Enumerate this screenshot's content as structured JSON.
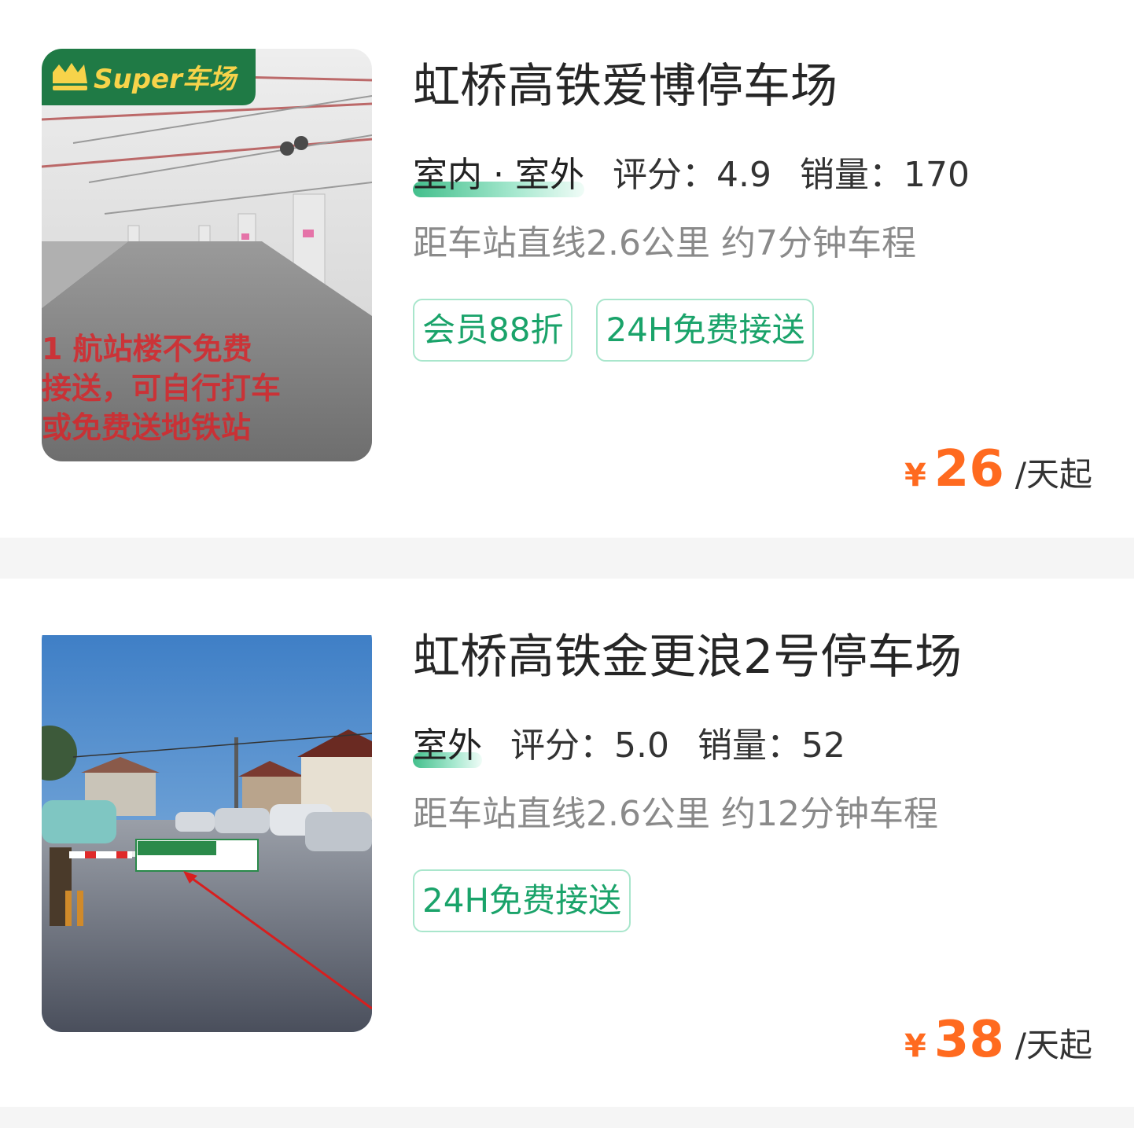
{
  "lots": [
    {
      "badge": "Super车场",
      "image_caption_lines": [
        "1 航站楼不免费",
        "接送，可自行打车",
        "或免费送地铁站"
      ],
      "name": "虹桥高铁爱博停车场",
      "type": "室内 · 室外",
      "rating_label": "评分：4.9",
      "sales_label": "销量：170",
      "distance": "距车站直线2.6公里 约7分钟车程",
      "tags": [
        "会员88折",
        "24H免费接送"
      ],
      "currency": "¥",
      "price": "26",
      "unit": "/天起"
    },
    {
      "name": "虹桥高铁金更浪2号停车场",
      "type": "室外",
      "rating_label": "评分：5.0",
      "sales_label": "销量：52",
      "distance": "距车站直线2.6公里 约12分钟车程",
      "tags": [
        "24H免费接送"
      ],
      "currency": "¥",
      "price": "38",
      "unit": "/天起"
    }
  ],
  "colors": {
    "accent_green": "#1aa36a",
    "price_orange": "#ff6a1f",
    "badge_green": "#1f7a45",
    "badge_gold": "#f7d34a"
  }
}
